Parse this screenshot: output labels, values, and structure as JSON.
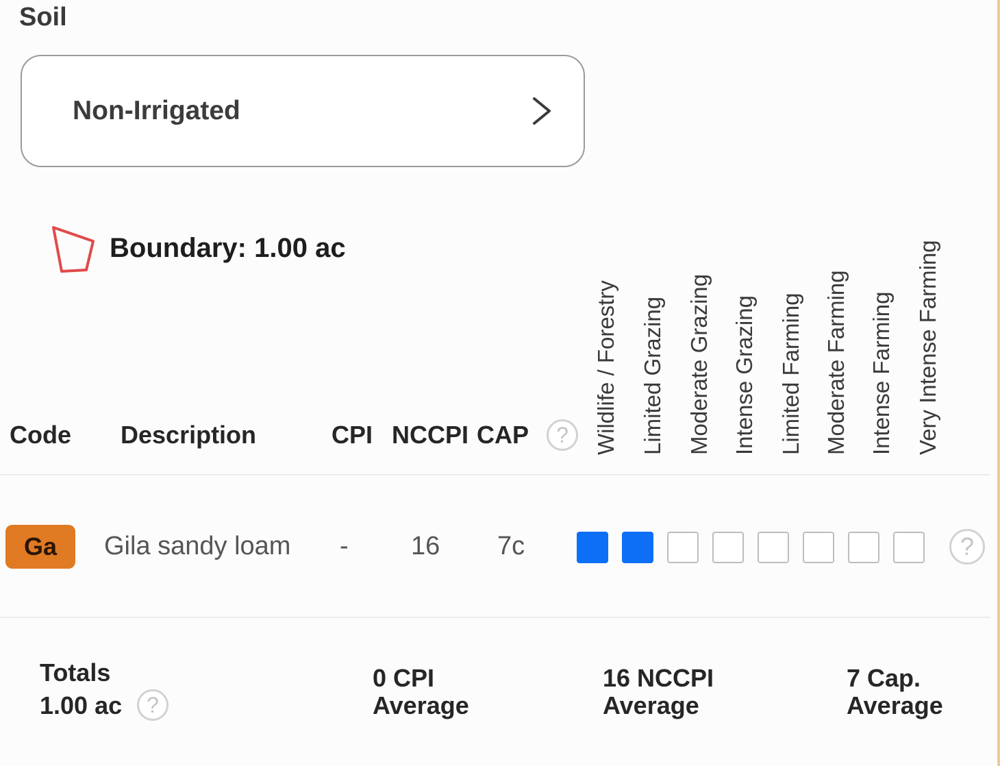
{
  "section": {
    "title": "Soil"
  },
  "irrigation": {
    "label": "Non-Irrigated",
    "chevron_icon": "chevron-right-icon"
  },
  "boundary": {
    "icon": "polygon-boundary-icon",
    "label": "Boundary: 1.00 ac",
    "icon_color": "#e04a4a"
  },
  "table": {
    "headers": {
      "code": "Code",
      "description": "Description",
      "cpi": "CPI",
      "nccpi": "NCCPI",
      "cap": "CAP",
      "help": "?"
    },
    "land_use": [
      "Wildlife / Forestry",
      "Limited Grazing",
      "Moderate Grazing",
      "Intense Grazing",
      "Limited Farming",
      "Moderate Farming",
      "Intense Farming",
      "Very Intense Farming"
    ],
    "rows": [
      {
        "code": "Ga",
        "code_color": "#e07a23",
        "description": "Gila sandy loam",
        "cpi": "-",
        "nccpi": "16",
        "cap": "7c",
        "capability_filled": [
          true,
          true,
          false,
          false,
          false,
          false,
          false,
          false
        ],
        "help": "?"
      }
    ]
  },
  "totals": {
    "label": "Totals",
    "area": "1.00 ac",
    "help": "?",
    "cpi_value": "0 CPI",
    "cpi_caption": "Average",
    "nccpi_value": "16 NCCPI",
    "nccpi_caption": "Average",
    "cap_value": "7 Cap.",
    "cap_caption": "Average"
  },
  "colors": {
    "filled_square": "#0d6ef6",
    "accent_border": "#f0c89a"
  }
}
